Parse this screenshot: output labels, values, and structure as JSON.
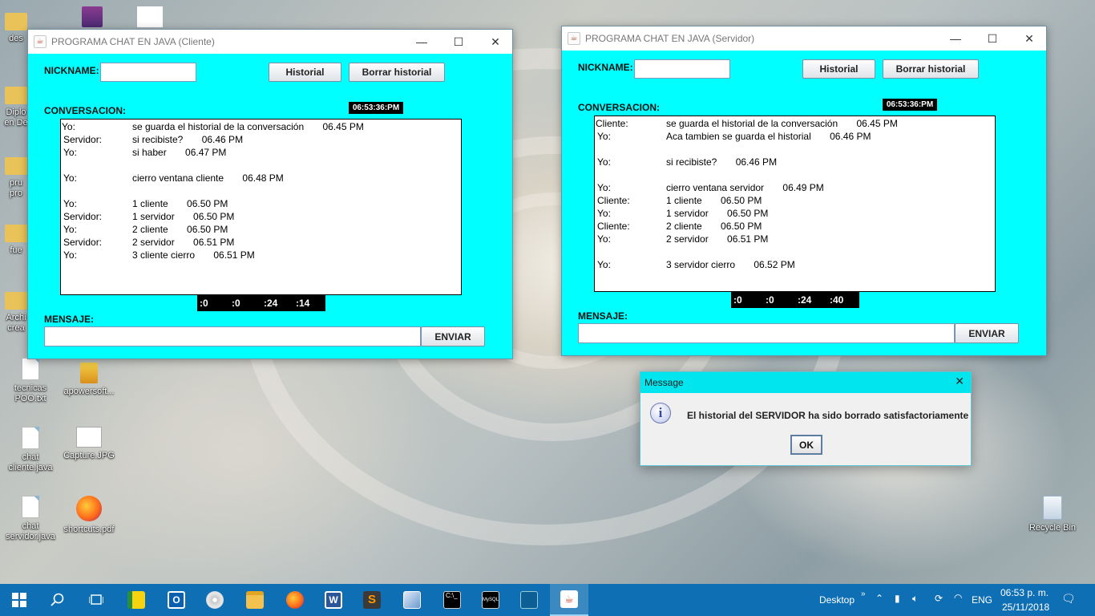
{
  "desktop": {
    "icons": [
      {
        "label": "des"
      },
      {
        "label": "Diplo"
      },
      {
        "label": "en De"
      },
      {
        "label": "pru"
      },
      {
        "label": "pro"
      },
      {
        "label": "fue"
      },
      {
        "label": "Archi"
      },
      {
        "label": "crea"
      },
      {
        "label": "tecnicas POO.txt"
      },
      {
        "label": "apowersoft..."
      },
      {
        "label": "chat cliente.java"
      },
      {
        "label": "Capture.JPG"
      },
      {
        "label": "chat servidor.java"
      },
      {
        "label": "shortcuts.pdf"
      },
      {
        "label": "Recycle Bin"
      }
    ]
  },
  "client": {
    "title": "PROGRAMA CHAT EN JAVA (Cliente)",
    "nickname_label": "NICKNAME:",
    "nickname_value": "",
    "historial_button": "Historial",
    "borrar_button": "Borrar historial",
    "conversacion_label": "CONVERSACION:",
    "clock": "06:53:36:PM",
    "messages": [
      {
        "who": "Yo:",
        "text": "se guarda el historial de la conversación       06.45 PM"
      },
      {
        "who": "Servidor:",
        "text": "si recibiste?       06.46 PM"
      },
      {
        "who": "Yo:",
        "text": "si haber       06.47 PM"
      },
      {
        "who": "",
        "text": ""
      },
      {
        "who": "Yo:",
        "text": "cierro ventana cliente       06.48 PM"
      },
      {
        "who": "",
        "text": ""
      },
      {
        "who": "Yo:",
        "text": "1 cliente       06.50 PM"
      },
      {
        "who": "Servidor:",
        "text": "1 servidor       06.50 PM"
      },
      {
        "who": "Yo:",
        "text": "2 cliente       06.50 PM"
      },
      {
        "who": "Servidor:",
        "text": "2 servidor       06.51 PM"
      },
      {
        "who": "Yo:",
        "text": "3 cliente cierro       06.51 PM"
      }
    ],
    "timer": [
      ":0",
      ":0",
      ":24",
      ":14"
    ],
    "mensaje_label": "MENSAJE:",
    "mensaje_value": "",
    "enviar_button": "ENVIAR"
  },
  "server": {
    "title": "PROGRAMA CHAT EN JAVA (Servidor)",
    "nickname_label": "NICKNAME:",
    "nickname_value": "",
    "historial_button": "Historial",
    "borrar_button": "Borrar historial",
    "conversacion_label": "CONVERSACION:",
    "clock": "06:53:36:PM",
    "messages": [
      {
        "who": "Cliente:",
        "text": "se guarda el historial de la conversación       06.45 PM"
      },
      {
        "who": "Yo:",
        "text": "Aca tambien se guarda el historial       06.46 PM"
      },
      {
        "who": "",
        "text": ""
      },
      {
        "who": "Yo:",
        "text": "si recibiste?       06.46 PM"
      },
      {
        "who": "",
        "text": ""
      },
      {
        "who": "Yo:",
        "text": "cierro ventana servidor       06.49 PM"
      },
      {
        "who": "Cliente:",
        "text": "1 cliente       06.50 PM"
      },
      {
        "who": "Yo:",
        "text": "1 servidor       06.50 PM"
      },
      {
        "who": "Cliente:",
        "text": "2 cliente       06.50 PM"
      },
      {
        "who": "Yo:",
        "text": "2 servidor       06.51 PM"
      },
      {
        "who": "",
        "text": ""
      },
      {
        "who": "Yo:",
        "text": "3 servidor cierro       06.52 PM"
      }
    ],
    "timer": [
      ":0",
      ":0",
      ":24",
      ":40"
    ],
    "mensaje_label": "MENSAJE:",
    "mensaje_value": "",
    "enviar_button": "ENVIAR"
  },
  "dialog": {
    "title": "Message",
    "message": "El historial del SERVIDOR ha sido borrado satisfactoriamente",
    "ok_button": "OK"
  },
  "taskbar": {
    "desktop_label": "Desktop",
    "language": "ENG",
    "time": "06:53 p. m.",
    "date": "25/11/2018",
    "apps": [
      "start-icon",
      "search-icon",
      "task-view-icon",
      "sticky-notes-icon",
      "outlook-icon",
      "disc-icon",
      "file-explorer-icon",
      "firefox-icon",
      "word-icon",
      "sublime-icon",
      "virtualbox-icon",
      "cmd-icon",
      "mysql-icon",
      "workbench-icon",
      "java-icon"
    ]
  },
  "colors": {
    "window_bg": "#00ffff",
    "taskbar": "#0f6fb4",
    "dialog_title": "#00e5ee"
  }
}
